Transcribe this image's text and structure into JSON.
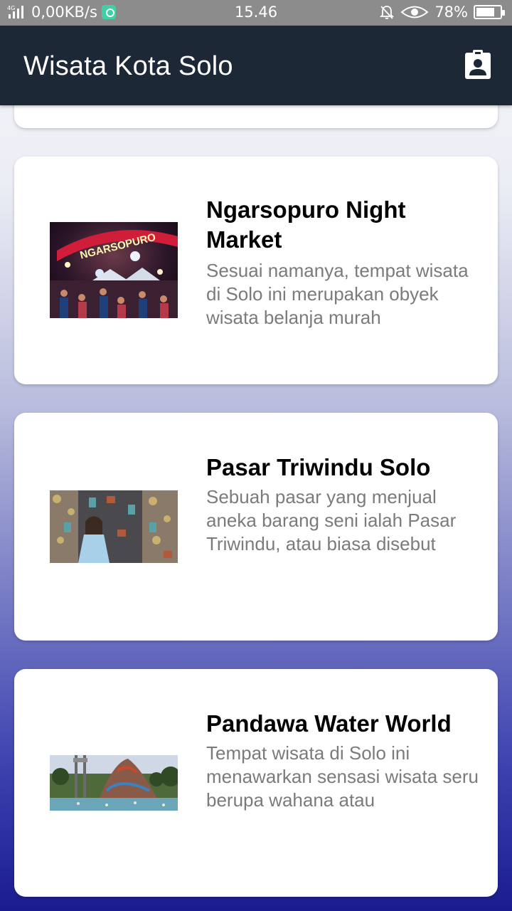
{
  "status_bar": {
    "network_type": "4G",
    "data_rate": "0,00KB/s",
    "time": "15.46",
    "battery_percent": "78%",
    "battery_level": 0.78
  },
  "app_bar": {
    "title": "Wisata Kota Solo",
    "action_icon": "contact-card-icon"
  },
  "places": [
    {
      "title": "Ngarsopuro Night Market",
      "description": "Sesuai namanya, tempat wisata di Solo ini merupakan obyek wisata belanja murah",
      "photo_sign": "NGARSOPURO"
    },
    {
      "title": "Pasar Triwindu Solo",
      "description": "Sebuah pasar yang menjual aneka barang seni ialah Pasar Triwindu, atau biasa disebut"
    },
    {
      "title": "Pandawa Water World",
      "description": "Tempat wisata di Solo ini menawarkan sensasi wisata seru berupa wahana atau"
    }
  ]
}
